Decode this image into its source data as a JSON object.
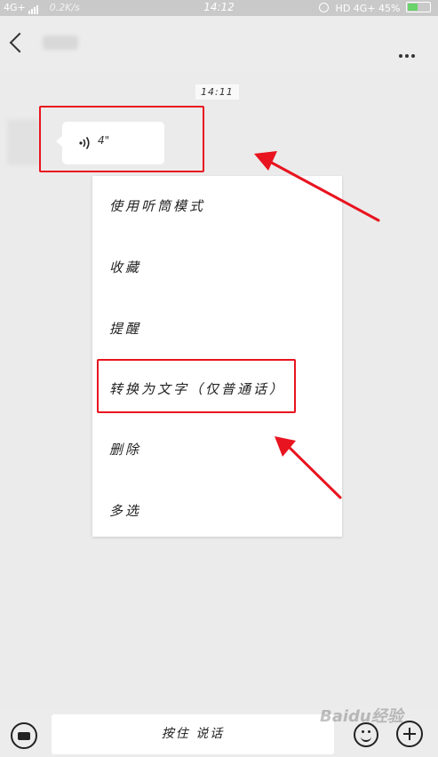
{
  "status_bar": {
    "network": "4G+",
    "speed": "0.2K/s",
    "time": "14:12",
    "hd": "HD",
    "network2": "4G+",
    "battery": "45%",
    "battery_level": 0.45
  },
  "nav": {
    "back_icon": "chevron-left-icon",
    "more_icon": "more-dots-icon"
  },
  "chat": {
    "timestamp": "14:11",
    "voice_duration": "4\""
  },
  "context_menu": {
    "items": [
      {
        "label": "使用听筒模式"
      },
      {
        "label": "收藏"
      },
      {
        "label": "提醒"
      },
      {
        "label": "转换为文字（仅普通话）"
      },
      {
        "label": "删除"
      },
      {
        "label": "多选"
      }
    ]
  },
  "input_bar": {
    "hold_to_talk": "按住 说话"
  },
  "watermark": "Baidu经验",
  "colors": {
    "highlight": "#e8141f",
    "background": "#ebebeb"
  }
}
